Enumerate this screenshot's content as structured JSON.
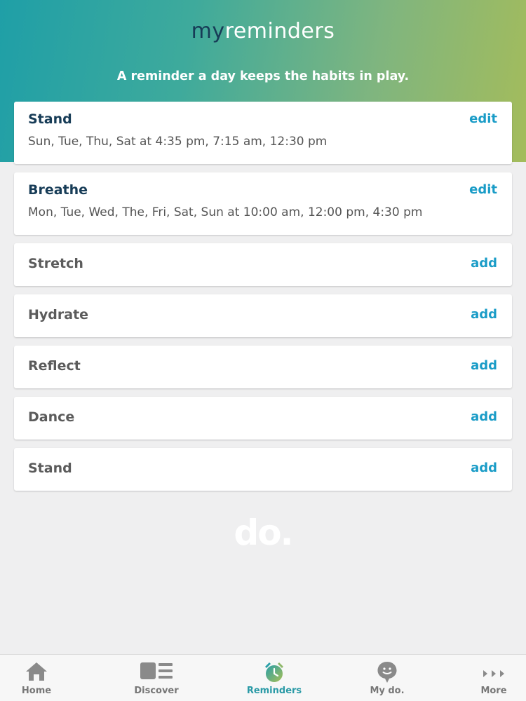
{
  "header": {
    "title_prefix": "my",
    "title_main": "reminders",
    "tagline": "A reminder a day keeps the habits in play."
  },
  "reminders": [
    {
      "title": "Stand",
      "schedule": "Sun, Tue, Thu, Sat at 4:35 pm, 7:15 am, 12:30 pm",
      "action": "edit"
    },
    {
      "title": "Breathe",
      "schedule": "Mon, Tue, Wed, The, Fri, Sat, Sun at 10:00 am, 12:00 pm, 4:30 pm",
      "action": "edit"
    },
    {
      "title": "Stretch",
      "action": "add"
    },
    {
      "title": "Hydrate",
      "action": "add"
    },
    {
      "title": "Reflect",
      "action": "add"
    },
    {
      "title": "Dance",
      "action": "add"
    },
    {
      "title": "Stand",
      "action": "add"
    }
  ],
  "watermark": "do.",
  "tabs": [
    {
      "label": "Home",
      "icon": "home-icon"
    },
    {
      "label": "Discover",
      "icon": "discover-icon"
    },
    {
      "label": "Reminders",
      "icon": "alarm-clock-icon",
      "active": true
    },
    {
      "label": "My do.",
      "icon": "profile-pin-icon"
    },
    {
      "label": "More",
      "icon": "more-arrows-icon"
    }
  ],
  "colors": {
    "gradient_start": "#1f9fa7",
    "gradient_end": "#a4bc5b",
    "title_dark": "#173c57",
    "action": "#1a9cc7",
    "tab_active": "#2a9aa6"
  }
}
